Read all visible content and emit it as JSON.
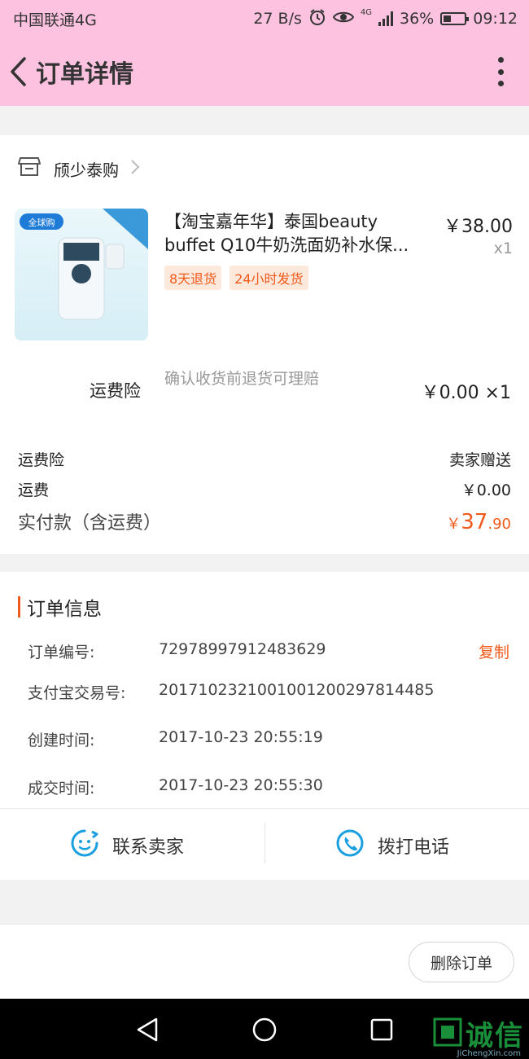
{
  "status_bar": {
    "carrier": "中国联通4G",
    "speed": "27 B/s",
    "network": "4G",
    "battery": "36%",
    "time": "09:12"
  },
  "nav": {
    "title": "订单详情"
  },
  "shop": {
    "name": "颀少泰购"
  },
  "product": {
    "title_line1": "【淘宝嘉年华】泰国beauty",
    "title_line2": "buffet Q10牛奶洗面奶补水保...",
    "price": "￥38.00",
    "qty": "x1",
    "tags": [
      "8天退货",
      "24小时发货"
    ],
    "image_badge": "全球购"
  },
  "insurance": {
    "label": "运费险",
    "desc": "确认收货前退货可理赔",
    "price": "￥0.00 ×1"
  },
  "summary": {
    "rows": [
      {
        "label": "运费险",
        "value": "卖家赠送"
      },
      {
        "label": "运费",
        "value": "￥0.00"
      }
    ],
    "pay_label": "实付款（含运费）",
    "pay_currency": "￥",
    "pay_int": "37",
    "pay_dec": ".90"
  },
  "order_info": {
    "title": "订单信息",
    "copy_label": "复制",
    "rows": [
      {
        "label": "订单编号:",
        "value": "72978997912483629"
      },
      {
        "label": "支付宝交易号:",
        "value": "2017102321001001200297814485"
      },
      {
        "label": "创建时间:",
        "value": "2017-10-23 20:55:19"
      },
      {
        "label": "成交时间:",
        "value": "2017-10-23 20:55:30"
      }
    ]
  },
  "actions": {
    "contact_seller": "联系卖家",
    "call_phone": "拨打电话",
    "delete_order": "删除订单"
  },
  "watermark": {
    "text": "诚信",
    "sub": "JiChengXin.com"
  },
  "colors": {
    "header_bg": "#fdc2e0",
    "accent": "#f05a1a",
    "icon_blue": "#1a9fe0"
  }
}
